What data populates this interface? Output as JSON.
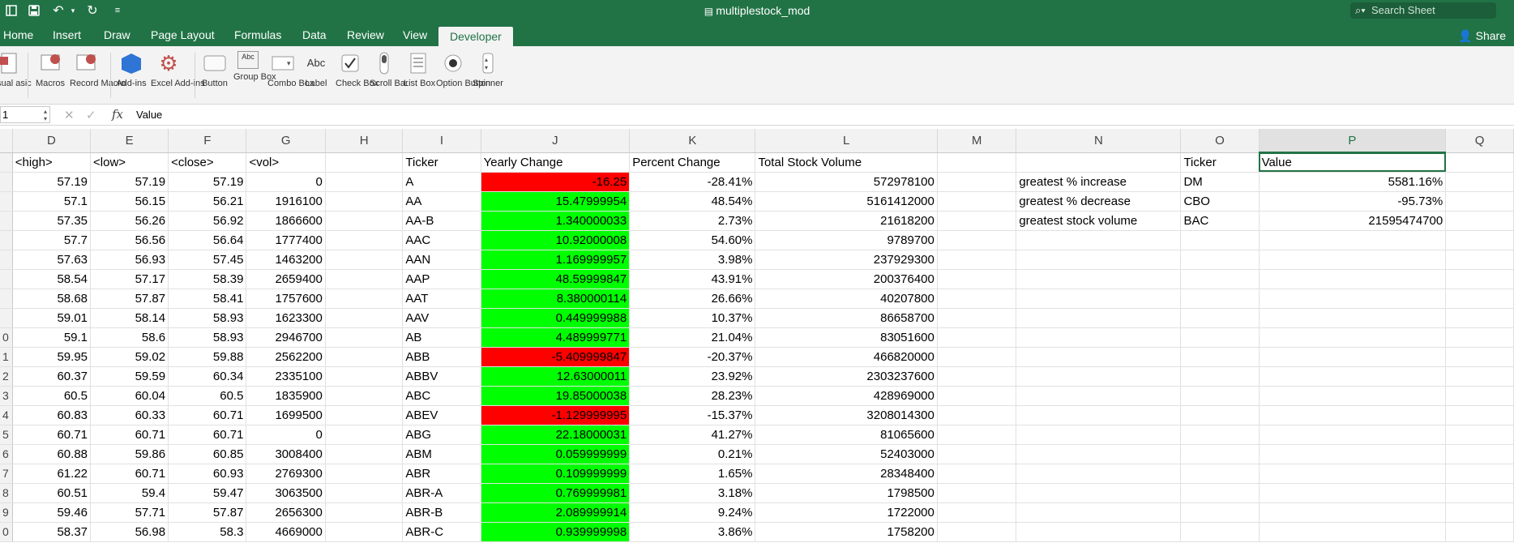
{
  "window": {
    "title": "multiplestock_mod",
    "search_placeholder": "Search Sheet"
  },
  "titlebar_icons": [
    "sidebar-icon",
    "save-icon",
    "undo-icon",
    "redo-icon",
    "customize-icon"
  ],
  "tabs": [
    "Home",
    "Insert",
    "Draw",
    "Page Layout",
    "Formulas",
    "Data",
    "Review",
    "View",
    "Developer"
  ],
  "active_tab": "Developer",
  "share_label": "Share",
  "ribbon": [
    {
      "name": "visual-basic",
      "label": "sual asic"
    },
    {
      "name": "macros",
      "label": "Macros"
    },
    {
      "name": "record-macro",
      "label": "Record Macro"
    },
    {
      "name": "add-ins",
      "label": "Add-ins"
    },
    {
      "name": "excel-add-ins",
      "label": "Excel Add-ins"
    },
    {
      "name": "button",
      "label": "Button"
    },
    {
      "name": "group-box",
      "label": "Group Box"
    },
    {
      "name": "combo-box",
      "label": "Combo Box"
    },
    {
      "name": "label",
      "label": "Label"
    },
    {
      "name": "check-box",
      "label": "Check Box"
    },
    {
      "name": "scroll-bar",
      "label": "Scroll Bar"
    },
    {
      "name": "list-box",
      "label": "List Box"
    },
    {
      "name": "option-button",
      "label": "Option Button"
    },
    {
      "name": "spinner",
      "label": "Spinner"
    }
  ],
  "formula_bar": {
    "name_box": "1",
    "formula": "Value"
  },
  "columns": [
    "D",
    "E",
    "F",
    "G",
    "H",
    "I",
    "J",
    "K",
    "L",
    "M",
    "N",
    "O",
    "P",
    "Q"
  ],
  "selected_column": "P",
  "row_numbers": [
    "",
    "",
    "",
    "",
    "",
    "",
    "",
    "",
    "",
    "0",
    "1",
    "2",
    "3",
    "4",
    "5",
    "6",
    "7",
    "8",
    "9",
    "0"
  ],
  "headers": {
    "D": "<high>",
    "E": "<low>",
    "F": "<close>",
    "G": "<vol>",
    "I": "Ticker",
    "J": "Yearly Change",
    "K": "Percent Change",
    "L": "Total Stock Volume",
    "O": "Ticker",
    "P": "Value"
  },
  "rows": [
    {
      "D": "57.19",
      "E": "57.19",
      "F": "57.19",
      "G": "0",
      "I": "A",
      "J": "-16.25",
      "K": "-28.41%",
      "L": "572978100"
    },
    {
      "D": "57.1",
      "E": "56.15",
      "F": "56.21",
      "G": "1916100",
      "I": "AA",
      "J": "15.47999954",
      "K": "48.54%",
      "L": "5161412000"
    },
    {
      "D": "57.35",
      "E": "56.26",
      "F": "56.92",
      "G": "1866600",
      "I": "AA-B",
      "J": "1.340000033",
      "K": "2.73%",
      "L": "21618200"
    },
    {
      "D": "57.7",
      "E": "56.56",
      "F": "56.64",
      "G": "1777400",
      "I": "AAC",
      "J": "10.92000008",
      "K": "54.60%",
      "L": "9789700"
    },
    {
      "D": "57.63",
      "E": "56.93",
      "F": "57.45",
      "G": "1463200",
      "I": "AAN",
      "J": "1.169999957",
      "K": "3.98%",
      "L": "237929300"
    },
    {
      "D": "58.54",
      "E": "57.17",
      "F": "58.39",
      "G": "2659400",
      "I": "AAP",
      "J": "48.59999847",
      "K": "43.91%",
      "L": "200376400"
    },
    {
      "D": "58.68",
      "E": "57.87",
      "F": "58.41",
      "G": "1757600",
      "I": "AAT",
      "J": "8.380000114",
      "K": "26.66%",
      "L": "40207800"
    },
    {
      "D": "59.01",
      "E": "58.14",
      "F": "58.93",
      "G": "1623300",
      "I": "AAV",
      "J": "0.449999988",
      "K": "10.37%",
      "L": "86658700"
    },
    {
      "D": "59.1",
      "E": "58.6",
      "F": "58.93",
      "G": "2946700",
      "I": "AB",
      "J": "4.489999771",
      "K": "21.04%",
      "L": "83051600"
    },
    {
      "D": "59.95",
      "E": "59.02",
      "F": "59.88",
      "G": "2562200",
      "I": "ABB",
      "J": "-5.409999847",
      "K": "-20.37%",
      "L": "466820000"
    },
    {
      "D": "60.37",
      "E": "59.59",
      "F": "60.34",
      "G": "2335100",
      "I": "ABBV",
      "J": "12.63000011",
      "K": "23.92%",
      "L": "2303237600"
    },
    {
      "D": "60.5",
      "E": "60.04",
      "F": "60.5",
      "G": "1835900",
      "I": "ABC",
      "J": "19.85000038",
      "K": "28.23%",
      "L": "428969000"
    },
    {
      "D": "60.83",
      "E": "60.33",
      "F": "60.71",
      "G": "1699500",
      "I": "ABEV",
      "J": "-1.129999995",
      "K": "-15.37%",
      "L": "3208014300"
    },
    {
      "D": "60.71",
      "E": "60.71",
      "F": "60.71",
      "G": "0",
      "I": "ABG",
      "J": "22.18000031",
      "K": "41.27%",
      "L": "81065600"
    },
    {
      "D": "60.88",
      "E": "59.86",
      "F": "60.85",
      "G": "3008400",
      "I": "ABM",
      "J": "0.059999999",
      "K": "0.21%",
      "L": "52403000"
    },
    {
      "D": "61.22",
      "E": "60.71",
      "F": "60.93",
      "G": "2769300",
      "I": "ABR",
      "J": "0.109999999",
      "K": "1.65%",
      "L": "28348400"
    },
    {
      "D": "60.51",
      "E": "59.4",
      "F": "59.47",
      "G": "3063500",
      "I": "ABR-A",
      "J": "0.769999981",
      "K": "3.18%",
      "L": "1798500"
    },
    {
      "D": "59.46",
      "E": "57.71",
      "F": "57.87",
      "G": "2656300",
      "I": "ABR-B",
      "J": "2.089999914",
      "K": "9.24%",
      "L": "1722000"
    },
    {
      "D": "58.37",
      "E": "56.98",
      "F": "58.3",
      "G": "4669000",
      "I": "ABR-C",
      "J": "0.939999998",
      "K": "3.86%",
      "L": "1758200"
    }
  ],
  "summary": [
    {
      "label": "greatest % increase",
      "ticker": "DM",
      "value": "5581.16%"
    },
    {
      "label": "greatest % decrease",
      "ticker": "CBO",
      "value": "-95.73%"
    },
    {
      "label": "greatest stock volume",
      "ticker": "BAC",
      "value": "21595474700"
    }
  ],
  "colors": {
    "excel_green": "#217346",
    "positive": "#00ff00",
    "negative": "#ff0000"
  }
}
